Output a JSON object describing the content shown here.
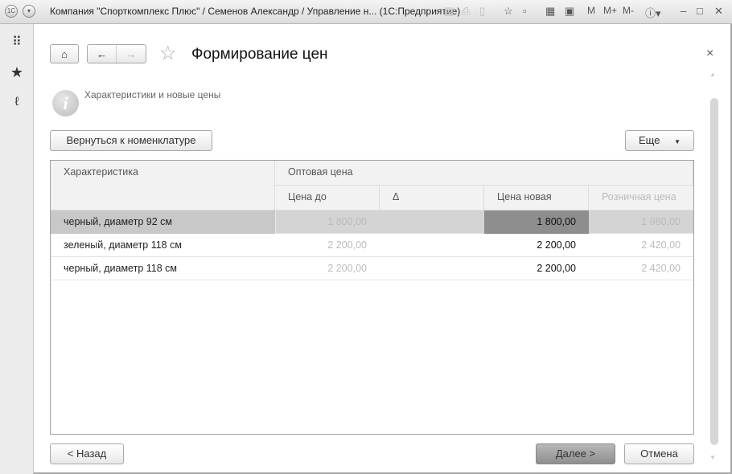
{
  "window": {
    "title": "Компания \"Спорткомплекс Плюс\" / Семенов Александр / Управление н...  (1С:Предприятие)",
    "toolbar_icons": [
      "save-icon",
      "print-icon",
      "preview-icon",
      "favorite-add-icon",
      "bookmark-icon",
      "calculator-icon",
      "calendar-icon",
      "info-icon",
      "minimize-icon",
      "maximize-icon",
      "close-icon"
    ],
    "m": "M",
    "mplus": "M+",
    "mminus": "M-"
  },
  "sidebar": {
    "items": [
      "apps-grid-icon",
      "favorites-star-icon",
      "history-icon"
    ]
  },
  "form": {
    "title": "Формирование цен",
    "close": "×",
    "info": "Характеристики и новые цены",
    "back_to_nomenclature": "Вернуться к номенклатуре",
    "more": "Еще",
    "more_arrow": "▼"
  },
  "table": {
    "headers": {
      "characteristic": "Характеристика",
      "wholesale": "Оптовая цена",
      "price_before": "Цена до",
      "delta": "Δ",
      "price_new": "Цена новая",
      "retail": "Розничная цена"
    },
    "rows": [
      {
        "characteristic": "черный, диаметр 92 см",
        "price_before": "1 800,00",
        "delta": "",
        "price_new": "1 800,00",
        "retail": "1 980,00",
        "selected": true
      },
      {
        "characteristic": "зеленый, диаметр 118 см",
        "price_before": "2 200,00",
        "delta": "",
        "price_new": "2 200,00",
        "retail": "2 420,00"
      },
      {
        "characteristic": "черный, диаметр 118 см",
        "price_before": "2 200,00",
        "delta": "",
        "price_new": "2 200,00",
        "retail": "2 420,00"
      }
    ]
  },
  "footer": {
    "back": "< Назад",
    "next": "Далее >",
    "cancel": "Отмена"
  }
}
